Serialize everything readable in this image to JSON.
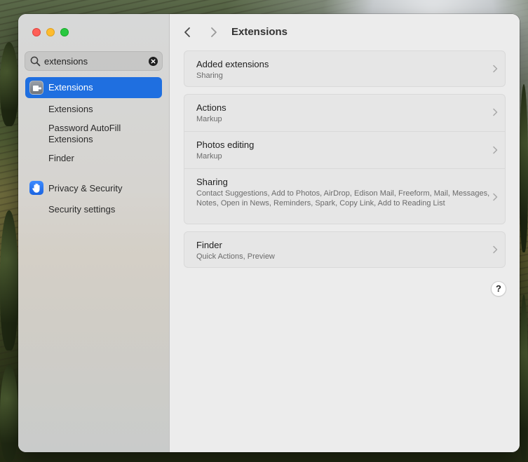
{
  "window": {
    "title": "Extensions"
  },
  "sidebar": {
    "search": {
      "value": "extensions",
      "icon": "search-icon",
      "clear_icon": "clear-icon"
    },
    "selected_item": {
      "label": "Extensions",
      "icon": "extensions-icon",
      "accent": "#1f6fe0"
    },
    "sub_items": [
      {
        "label": "Extensions"
      },
      {
        "label": "Password AutoFill Extensions"
      },
      {
        "label": "Finder"
      }
    ],
    "privacy_item": {
      "label": "Privacy & Security",
      "icon": "hand-icon"
    },
    "privacy_sub_items": [
      {
        "label": "Security settings"
      }
    ]
  },
  "groups": [
    {
      "rows": [
        {
          "title": "Added extensions",
          "subtitle": "Sharing"
        }
      ]
    },
    {
      "rows": [
        {
          "title": "Actions",
          "subtitle": "Markup"
        },
        {
          "title": "Photos editing",
          "subtitle": "Markup"
        },
        {
          "title": "Sharing",
          "subtitle": "Contact Suggestions, Add to Photos, AirDrop, Edison Mail, Freeform, Mail, Messages, Notes, Open in News, Reminders, Spark, Copy Link, Add to Reading List"
        }
      ]
    },
    {
      "rows": [
        {
          "title": "Finder",
          "subtitle": "Quick Actions, Preview"
        }
      ]
    }
  ],
  "help": {
    "label": "?"
  }
}
